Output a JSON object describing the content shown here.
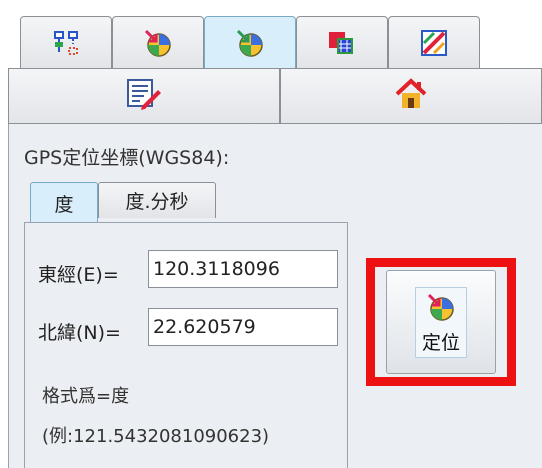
{
  "toolbar": {
    "tabs_row1": [
      {
        "icon": "network-tree-icon",
        "selected": false
      },
      {
        "icon": "globe-locate-icon",
        "selected": false
      },
      {
        "icon": "globe-locate-icon",
        "selected": true
      },
      {
        "icon": "grid-map-icon",
        "selected": false
      },
      {
        "icon": "route-map-icon",
        "selected": false
      }
    ],
    "tabs_row2": [
      {
        "icon": "edit-document-icon"
      },
      {
        "icon": "home-icon"
      }
    ]
  },
  "gps": {
    "title": "GPS定位坐標(WGS84):",
    "tabs": [
      "度",
      "度.分秒"
    ],
    "selected_tab": "度",
    "east_label": "東經(E)=",
    "east_value": "120.3118096",
    "north_label": "北緯(N)=",
    "north_value": "22.620579",
    "format_line": "格式爲=度",
    "example_line": "(例:121.5432081090623)",
    "locate_button": "定位",
    "locate_icon": "globe-locate-icon"
  },
  "colors": {
    "highlight": "#ee1111",
    "selected_tab": "#d9eefb",
    "panel": "#ebeef2"
  }
}
